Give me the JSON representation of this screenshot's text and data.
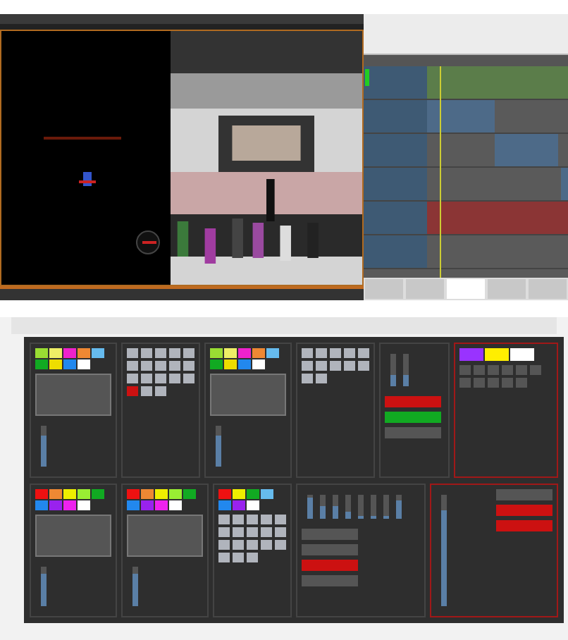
{
  "timeline": {
    "tracks": [
      {
        "marker": {
          "color": "#22cc22"
        },
        "clips": [
          {
            "color": "#5b7d4a"
          }
        ]
      },
      {
        "clips": [
          {
            "color": "#4d6a88"
          }
        ]
      },
      {
        "clips": [
          {
            "color": "#4d6a88"
          }
        ]
      },
      {
        "clips": [
          {
            "color": "#4d6a88"
          }
        ]
      },
      {
        "clips": [
          {
            "color": "#8b3535"
          }
        ]
      }
    ],
    "tabs": [
      {
        "selected": false
      },
      {
        "selected": false
      },
      {
        "selected": true
      },
      {
        "selected": false
      },
      {
        "selected": false
      }
    ]
  },
  "console": {
    "rows": [
      [
        {
          "kind": "pad",
          "palette": [
            {
              "color": "#99dd33"
            },
            {
              "color": "#eeee66"
            },
            {
              "color": "#ee22cc"
            },
            {
              "color": "#ee8833"
            },
            {
              "color": "#66bbee"
            },
            {
              "color": "#11aa22"
            },
            {
              "color": "#eedd00"
            },
            {
              "color": "#2288ee"
            },
            {
              "color": "#ffffff"
            }
          ],
          "faders": [
            {
              "level": 0.75
            }
          ]
        },
        {
          "kind": "buttons",
          "buttons": [
            {
              "color": "#b0b4bc"
            },
            {
              "color": "#b0b4bc"
            },
            {
              "color": "#b0b4bc"
            },
            {
              "color": "#b0b4bc"
            },
            {
              "color": "#b0b4bc"
            },
            {
              "color": "#b0b4bc"
            },
            {
              "color": "#b0b4bc"
            },
            {
              "color": "#b0b4bc"
            },
            {
              "color": "#b0b4bc"
            },
            {
              "color": "#b0b4bc"
            },
            {
              "color": "#b0b4bc"
            },
            {
              "color": "#b0b4bc"
            },
            {
              "color": "#b0b4bc"
            },
            {
              "color": "#b0b4bc"
            },
            {
              "color": "#b0b4bc"
            },
            {
              "color": "#cc1111"
            },
            {
              "color": "#b0b4bc"
            },
            {
              "color": "#b0b4bc"
            }
          ]
        },
        {
          "kind": "pad",
          "palette": [
            {
              "color": "#99dd33"
            },
            {
              "color": "#eeee66"
            },
            {
              "color": "#ee22cc"
            },
            {
              "color": "#ee8833"
            },
            {
              "color": "#66bbee"
            },
            {
              "color": "#11aa22"
            },
            {
              "color": "#eedd00"
            },
            {
              "color": "#2288ee"
            },
            {
              "color": "#ffffff"
            }
          ],
          "faders": [
            {
              "level": 0.75
            }
          ]
        },
        {
          "kind": "buttons",
          "buttons": [
            {
              "color": "#b0b4bc"
            },
            {
              "color": "#b0b4bc"
            },
            {
              "color": "#b0b4bc"
            },
            {
              "color": "#b0b4bc"
            },
            {
              "color": "#b0b4bc"
            },
            {
              "color": "#b0b4bc"
            },
            {
              "color": "#b0b4bc"
            },
            {
              "color": "#b0b4bc"
            },
            {
              "color": "#b0b4bc"
            },
            {
              "color": "#b0b4bc"
            },
            {
              "color": "#b0b4bc"
            },
            {
              "color": "#b0b4bc"
            }
          ]
        },
        {
          "kind": "faders",
          "faders": [
            {
              "level": 0.35
            },
            {
              "level": 0.35
            }
          ],
          "actions": [
            {
              "color": "#cc1111"
            },
            {
              "color": "#11aa22"
            },
            {
              "color": "#555555"
            }
          ]
        },
        {
          "kind": "swatches",
          "highlighted": true,
          "palette": [
            {
              "color": "#9933ff"
            },
            {
              "color": "#ffee00"
            },
            {
              "color": "#ffffff"
            }
          ],
          "buttons": [
            {
              "color": "#555555"
            },
            {
              "color": "#555555"
            },
            {
              "color": "#555555"
            },
            {
              "color": "#555555"
            },
            {
              "color": "#555555"
            },
            {
              "color": "#555555"
            },
            {
              "color": "#555555"
            },
            {
              "color": "#555555"
            },
            {
              "color": "#555555"
            },
            {
              "color": "#555555"
            },
            {
              "color": "#555555"
            }
          ]
        }
      ],
      [
        {
          "kind": "pad",
          "palette": [
            {
              "color": "#ee1111"
            },
            {
              "color": "#ee8833"
            },
            {
              "color": "#eeee00"
            },
            {
              "color": "#99ee33"
            },
            {
              "color": "#11aa22"
            },
            {
              "color": "#2288ee"
            },
            {
              "color": "#9922ee"
            },
            {
              "color": "#ee22ee"
            },
            {
              "color": "#ffffff"
            }
          ],
          "faders": [
            {
              "level": 0.8
            }
          ]
        },
        {
          "kind": "pad",
          "palette": [
            {
              "color": "#ee1111"
            },
            {
              "color": "#ee8833"
            },
            {
              "color": "#eeee00"
            },
            {
              "color": "#99ee33"
            },
            {
              "color": "#11aa22"
            },
            {
              "color": "#2288ee"
            },
            {
              "color": "#9922ee"
            },
            {
              "color": "#ee22ee"
            },
            {
              "color": "#ffffff"
            }
          ],
          "faders": [
            {
              "level": 0.8
            }
          ]
        },
        {
          "kind": "buttons",
          "palette": [
            {
              "color": "#ee1111"
            },
            {
              "color": "#eeee00"
            },
            {
              "color": "#11aa22"
            },
            {
              "color": "#66bbee"
            },
            {
              "color": "#2288ee"
            },
            {
              "color": "#9922ee"
            },
            {
              "color": "#ffffff"
            }
          ],
          "buttons": [
            {
              "color": "#b0b4bc"
            },
            {
              "color": "#b0b4bc"
            },
            {
              "color": "#b0b4bc"
            },
            {
              "color": "#b0b4bc"
            },
            {
              "color": "#b0b4bc"
            },
            {
              "color": "#b0b4bc"
            },
            {
              "color": "#b0b4bc"
            },
            {
              "color": "#b0b4bc"
            },
            {
              "color": "#b0b4bc"
            },
            {
              "color": "#b0b4bc"
            },
            {
              "color": "#b0b4bc"
            },
            {
              "color": "#b0b4bc"
            },
            {
              "color": "#b0b4bc"
            },
            {
              "color": "#b0b4bc"
            },
            {
              "color": "#b0b4bc"
            },
            {
              "color": "#b0b4bc"
            },
            {
              "color": "#b0b4bc"
            },
            {
              "color": "#b0b4bc"
            }
          ]
        },
        {
          "kind": "faders",
          "faders": [
            {
              "level": 0.85
            },
            {
              "level": 0.55
            },
            {
              "level": 0.55
            },
            {
              "level": 0.3
            },
            {
              "level": 0.1
            },
            {
              "level": 0.1
            },
            {
              "level": 0.1
            },
            {
              "level": 0.75
            }
          ],
          "actions": [
            {
              "color": "#555555"
            },
            {
              "color": "#555555"
            },
            {
              "color": "#cc1111"
            },
            {
              "color": "#555555"
            }
          ]
        },
        {
          "kind": "faders",
          "highlighted": true,
          "faders": [
            {
              "level": 0.85
            }
          ],
          "actions": [
            {
              "color": "#555555"
            },
            {
              "color": "#cc1111"
            },
            {
              "color": "#cc1111"
            }
          ]
        }
      ]
    ]
  }
}
